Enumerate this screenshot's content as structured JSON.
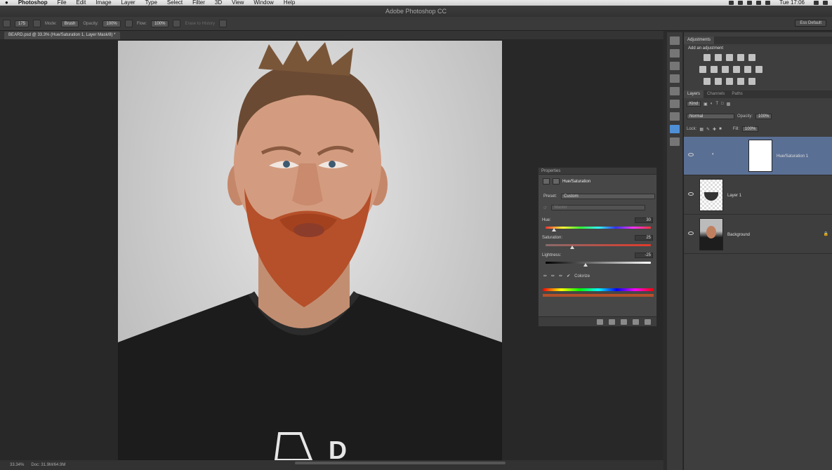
{
  "menubar": {
    "apple": "",
    "items": [
      "Photoshop",
      "File",
      "Edit",
      "Image",
      "Layer",
      "Type",
      "Select",
      "Filter",
      "3D",
      "View",
      "Window",
      "Help"
    ],
    "clock": "Tue 17:06"
  },
  "window": {
    "title": "Adobe Photoshop CC"
  },
  "options_bar": {
    "brush_size": "175",
    "mode_label": "Mode:",
    "mode_value": "Brush",
    "opacity_label": "Opacity:",
    "opacity_value": "100%",
    "flow_label": "Flow:",
    "flow_value": "100%",
    "erase_history": "Erase to History",
    "workspace": "Ess Default"
  },
  "document": {
    "tab": "BEARD.psd @ 33.3% (Hue/Saturation 1, Layer Mask/8) *",
    "zoom": "33.34%",
    "doc_size": "Doc: 31.9M/64.9M",
    "shirt_logo_text": "D"
  },
  "properties": {
    "header": "Properties",
    "title": "Hue/Saturation",
    "preset_label": "Preset:",
    "preset_value": "Custom",
    "channel_value": "Master",
    "hue_label": "Hue:",
    "hue_value": "30",
    "hue_position": 0.08,
    "saturation_label": "Saturation:",
    "saturation_value": "25",
    "saturation_position": 0.25,
    "lightness_label": "Lightness:",
    "lightness_value": "-25",
    "lightness_position": 0.38,
    "colorize_label": "Colorize",
    "colorize_checked": true
  },
  "adjustments": {
    "tab": "Adjustments",
    "subtitle": "Add an adjustment"
  },
  "layers_panel": {
    "tabs": [
      "Layers",
      "Channels",
      "Paths"
    ],
    "kind": "Kind",
    "blend_mode": "Normal",
    "opacity_label": "Opacity:",
    "opacity_value": "100%",
    "lock_label": "Lock:",
    "fill_label": "Fill:",
    "fill_value": "100%",
    "layers": [
      {
        "name": "Hue/Saturation 1",
        "selected": true
      },
      {
        "name": "Layer 1",
        "selected": false
      },
      {
        "name": "Background",
        "selected": false
      }
    ]
  },
  "colors": {
    "panel_bg": "#3e3e3e",
    "selected_layer": "#5a6f94",
    "active_tool": "#4f8fd6",
    "beard": "#b5502a"
  }
}
